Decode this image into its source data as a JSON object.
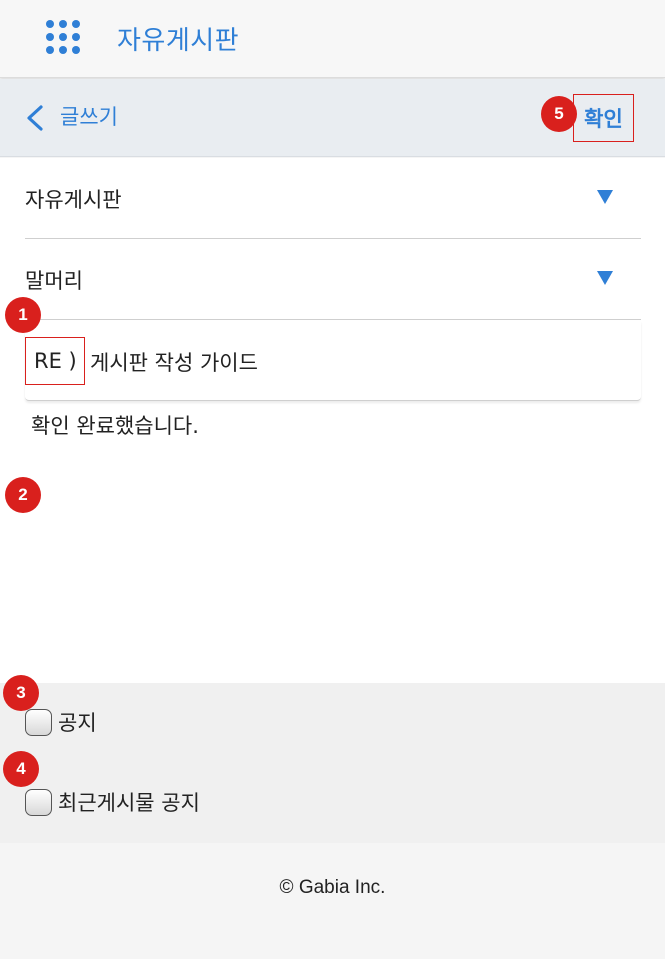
{
  "header": {
    "app_title": "자유게시판",
    "menu_icon": "grid-menu-icon",
    "accent_color": "#2f7fd6"
  },
  "subheader": {
    "back_icon": "chevron-left-icon",
    "back_label": "글쓰기",
    "confirm_label": "확인"
  },
  "form": {
    "board_select_value": "자유게시판",
    "prefix_select_value": "말머리",
    "subject_prefix": "RE )",
    "subject_value": "게시판 작성 가이드",
    "body_value": "확인 완료했습니다."
  },
  "options": {
    "notice_label": "공지",
    "recent_notice_label": "최근게시물 공지"
  },
  "annotations": {
    "badge_1": "1",
    "badge_2": "2",
    "badge_3": "3",
    "badge_4": "4",
    "badge_5": "5",
    "badge_color": "#d9201d"
  },
  "footer": {
    "copyright": "© Gabia Inc."
  }
}
